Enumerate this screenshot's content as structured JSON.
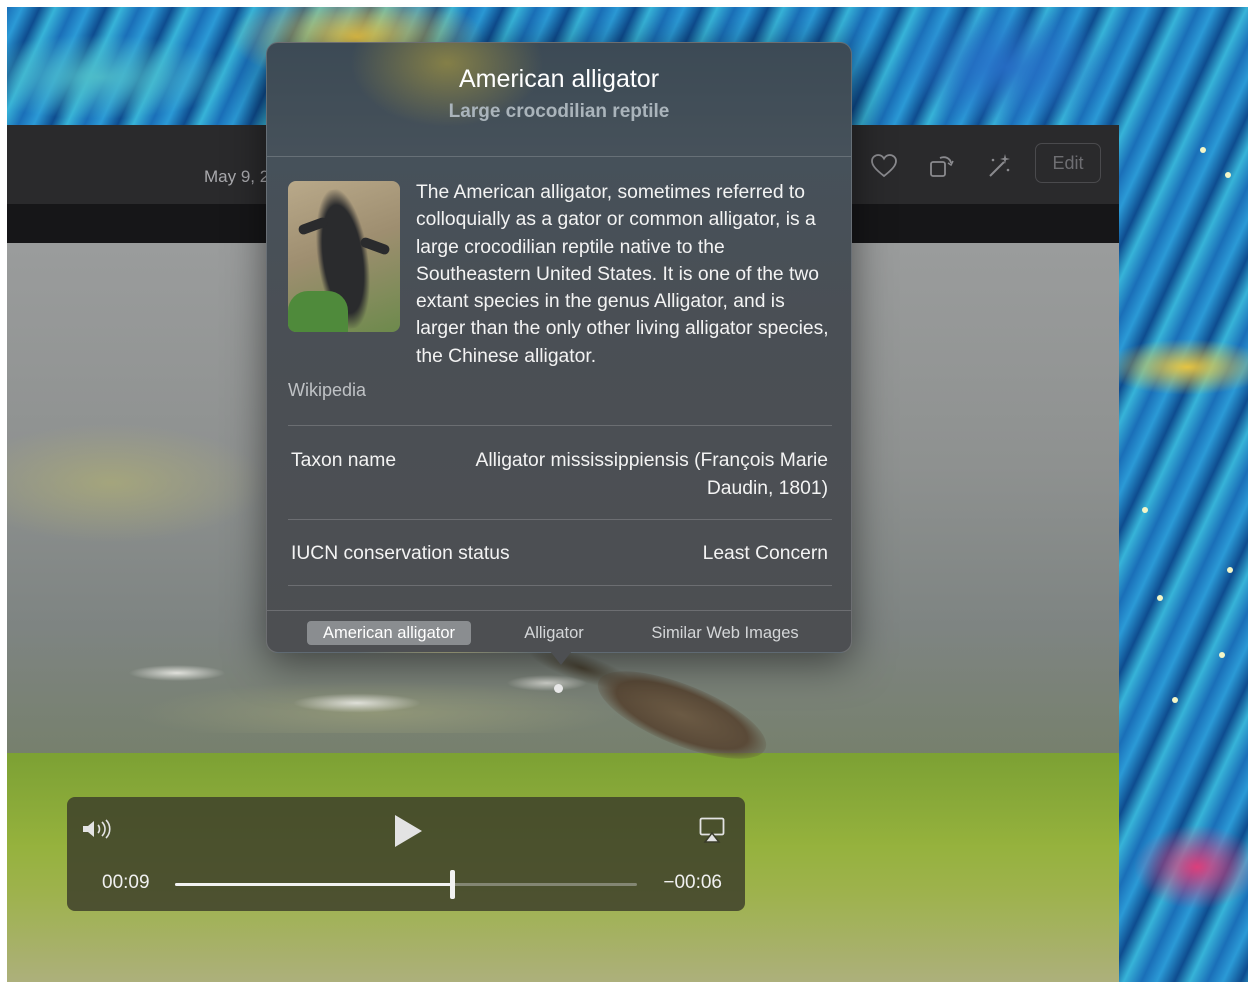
{
  "toolbar": {
    "date": "May 9, 2",
    "edit_label": "Edit",
    "icons": [
      "heart-icon",
      "rotate-icon",
      "enhance-icon"
    ]
  },
  "popover": {
    "title": "American alligator",
    "subtitle": "Large crocodilian reptile",
    "description": "The American alligator, sometimes referred to colloquially as a gator or common alligator, is a large crocodilian reptile native to the Southeastern United States. It is one of the two extant species in the genus Alligator, and is larger than the only other living alligator species, the Chinese alligator.",
    "source": "Wikipedia",
    "rows": [
      {
        "label": "Taxon name",
        "value_line1": "Alligator mississippiensis (François Marie",
        "value_line2": "Daudin, 1801)"
      },
      {
        "label": "IUCN conservation status",
        "value": "Least Concern"
      }
    ],
    "tabs": [
      {
        "label": "American alligator",
        "active": true
      },
      {
        "label": "Alligator",
        "active": false
      },
      {
        "label": "Similar Web Images",
        "active": false
      }
    ]
  },
  "player": {
    "elapsed": "00:09",
    "remaining": "−00:06",
    "progress": 0.6,
    "icons": [
      "volume-icon",
      "play-icon",
      "airplay-icon"
    ]
  }
}
